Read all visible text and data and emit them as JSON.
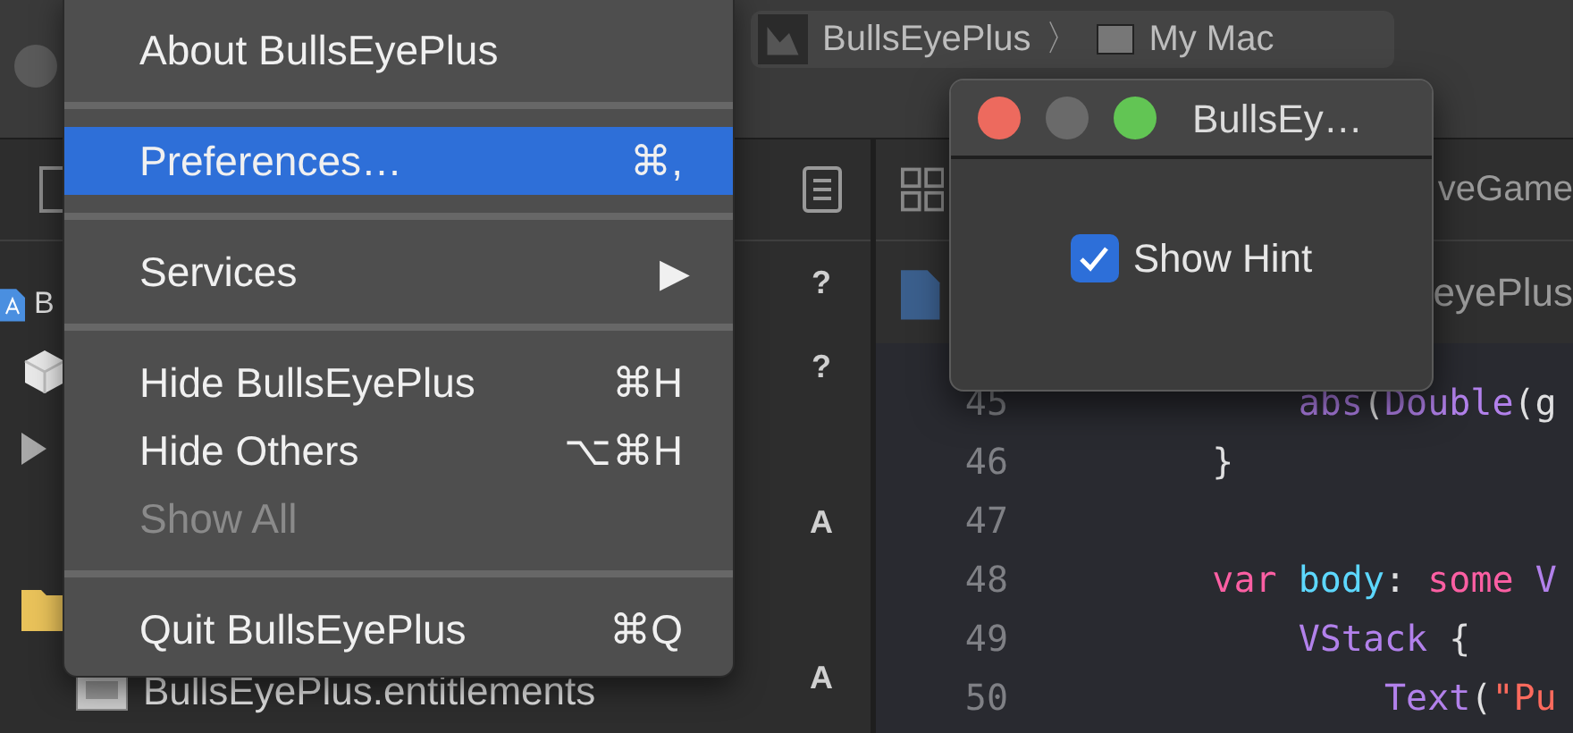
{
  "toolbar": {
    "breadcrumb": [
      {
        "label": "BullsEyePlus",
        "kind": "project"
      },
      {
        "label": "My Mac",
        "kind": "device"
      }
    ],
    "separator": "〉"
  },
  "navigator": {
    "rows": [
      {
        "label": "B",
        "kind": "project"
      },
      {
        "label": "",
        "kind": "cube"
      },
      {
        "label": "",
        "kind": "disclosure"
      },
      {
        "label": "",
        "kind": "folder"
      },
      {
        "label": "BullsEyePlus.entitlements",
        "kind": "entitlements"
      }
    ]
  },
  "status_column": [
    {
      "text": "?"
    },
    {
      "text": "?"
    },
    {
      "text": "A"
    },
    {
      "text": "A"
    }
  ],
  "editor": {
    "tab": "veGame",
    "jump_file": "eyePlus",
    "lines": [
      {
        "number": "45",
        "tokens": [
          {
            "text": "        abs",
            "kind": "call"
          },
          {
            "text": "(",
            "kind": "plain"
          },
          {
            "text": "Double",
            "kind": "call"
          },
          {
            "text": "(g",
            "kind": "plain"
          }
        ]
      },
      {
        "number": "46",
        "tokens": [
          {
            "text": "    }",
            "kind": "plain"
          }
        ]
      },
      {
        "number": "47"
      },
      {
        "number": "48",
        "tokens": [
          {
            "text": "    var",
            "kind": "keyword"
          },
          {
            "text": " body",
            "kind": "ident"
          },
          {
            "text": ": ",
            "kind": "plain"
          },
          {
            "text": "some",
            "kind": "keyword"
          },
          {
            "text": " V",
            "kind": "call"
          }
        ]
      },
      {
        "number": "49",
        "tokens": [
          {
            "text": "        VStack",
            "kind": "call"
          },
          {
            "text": " {",
            "kind": "plain"
          }
        ]
      },
      {
        "number": "50",
        "tokens": [
          {
            "text": "            Text",
            "kind": "call"
          },
          {
            "text": "(",
            "kind": "plain"
          },
          {
            "text": "\"Pu",
            "kind": "string"
          }
        ]
      }
    ]
  },
  "app_menu": [
    {
      "kind": "item",
      "label": "About BullsEyePlus",
      "selected": false,
      "disabled": false
    },
    {
      "kind": "separator"
    },
    {
      "kind": "item",
      "label": "Preferences…",
      "shortcut": "⌘,",
      "selected": true,
      "disabled": false
    },
    {
      "kind": "separator"
    },
    {
      "kind": "submenu",
      "label": "Services",
      "arrow": "▶",
      "selected": false,
      "disabled": false
    },
    {
      "kind": "separator"
    },
    {
      "kind": "item",
      "label": "Hide BullsEyePlus",
      "shortcut": "⌘H",
      "selected": false,
      "disabled": false
    },
    {
      "kind": "item",
      "label": "Hide Others",
      "shortcut": "⌥⌘H",
      "selected": false,
      "disabled": false
    },
    {
      "kind": "item",
      "label": "Show All",
      "selected": false,
      "disabled": true
    },
    {
      "kind": "separator"
    },
    {
      "kind": "item",
      "label": "Quit BullsEyePlus",
      "shortcut": "⌘Q",
      "selected": false,
      "disabled": false
    }
  ],
  "preferences_window": {
    "title": "BullsEy…",
    "checkbox": {
      "label": "Show Hint",
      "checked": true
    }
  }
}
